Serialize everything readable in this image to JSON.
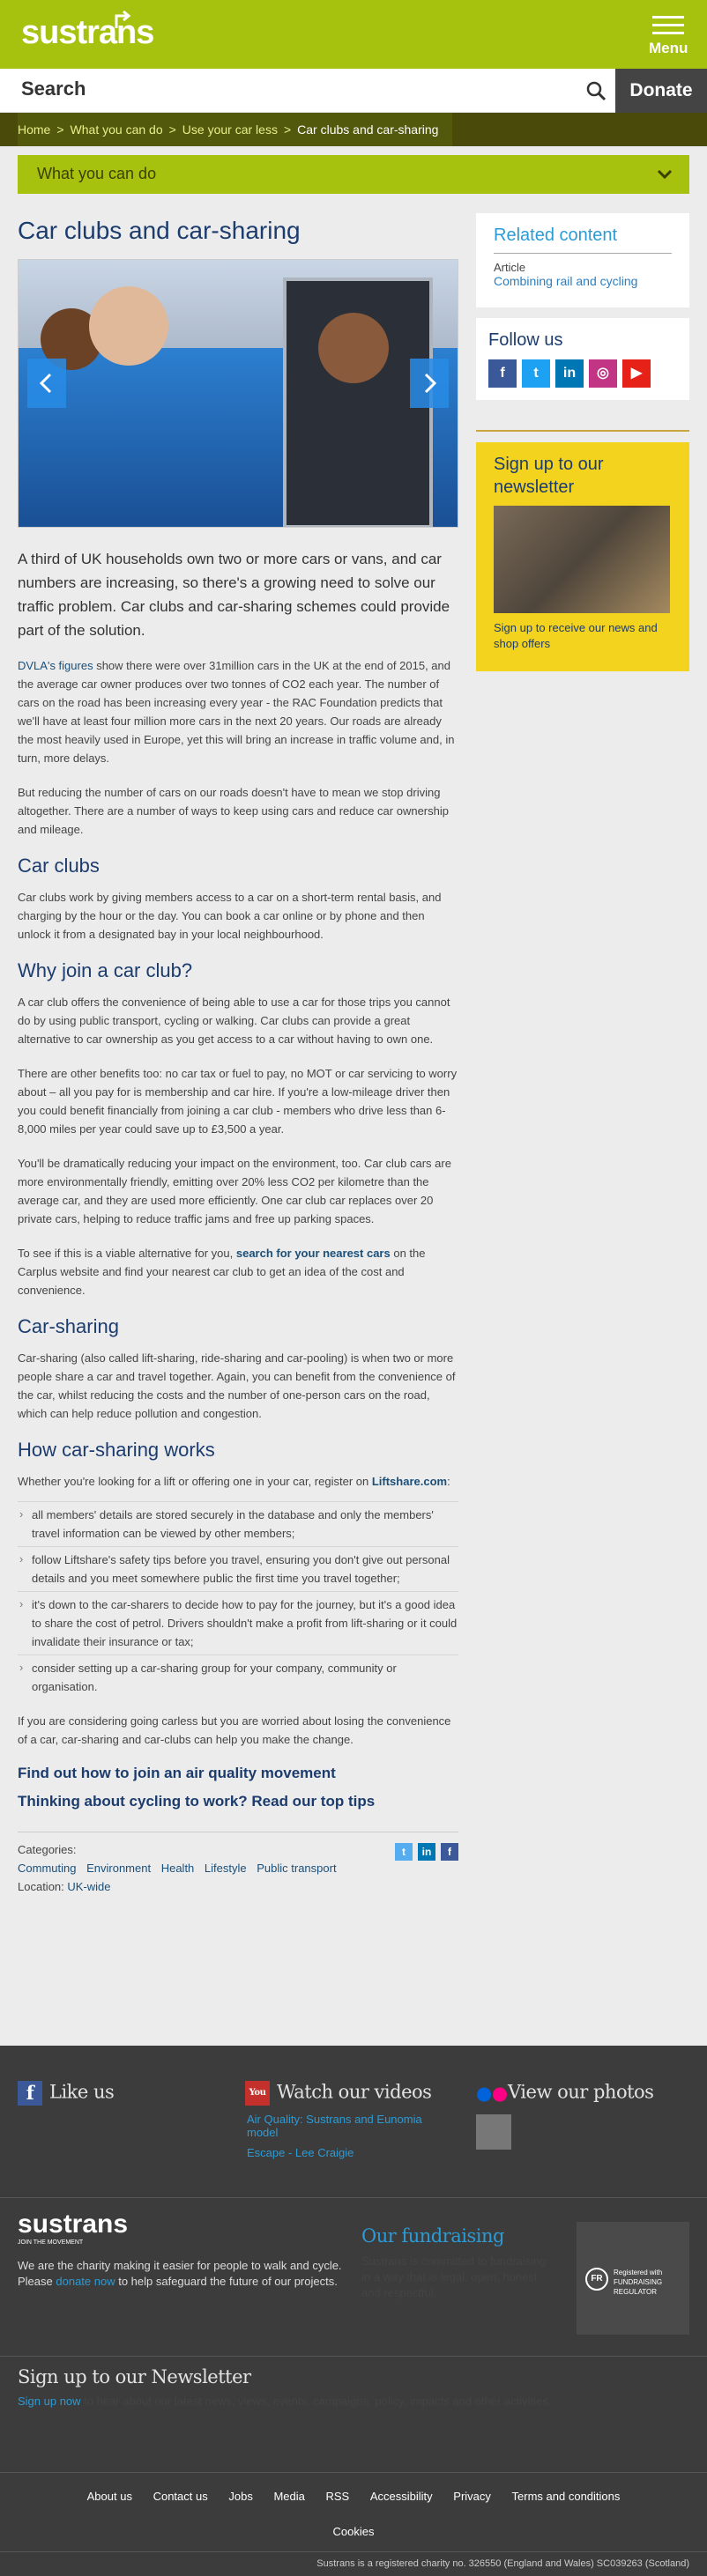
{
  "header": {
    "logo": "sustrans",
    "menu_label": "Menu",
    "search_placeholder": "Search",
    "donate": "Donate"
  },
  "breadcrumb": [
    "Home",
    "What you can do",
    "Use your car less",
    "Car clubs and car-sharing"
  ],
  "section_toggle": "What you can do",
  "page": {
    "title": "Car clubs and car-sharing",
    "lede": "A third of UK households own two or more cars or vans, and car numbers are increasing, so there's a growing need to solve our traffic problem. Car clubs and car-sharing schemes could provide part of the solution.",
    "p1_link": "DVLA's figures",
    "p1": " show there were over 31million cars in the UK at the end of 2015, and the average car owner produces over two tonnes of CO2 each year. The number of cars on the road has been increasing every year - the RAC Foundation predicts that we'll have at least four million more cars in the next 20 years. Our roads are already the most heavily used in Europe, yet this will bring an increase in traffic volume and, in turn, more delays.",
    "p2": "But reducing the number of cars on our roads doesn't have to mean we stop driving altogether. There are a number of ways to keep using cars and reduce car ownership and mileage.",
    "h_clubs": "Car clubs",
    "p3": "Car clubs work by giving members access to a car on a short-term rental basis, and charging by the hour or the day. You can book a car online or by phone and then unlock it from a designated bay in your local neighbourhood.",
    "h_why": "Why join a car club?",
    "p4": "A car club offers the convenience of being able to use a car for those trips you cannot do by using public transport, cycling or walking. Car clubs can provide a great alternative to car ownership as you get access to a car without having to own one.",
    "p5": "There are other benefits too: no car tax or fuel to pay, no MOT or car servicing to worry about – all you pay for is membership and car hire. If you're a low-mileage driver then you could benefit financially from joining a car club - members who drive less than 6-8,000 miles per year could save up to £3,500 a year.",
    "p6": "You'll be dramatically reducing your impact on the environment, too. Car club cars are more environmentally friendly, emitting over 20% less CO2 per kilometre than the average car, and they are used more efficiently. One car club car replaces over 20 private cars, helping to reduce traffic jams and free up parking spaces.",
    "p7_a": "To see if this is a viable alternative for you, ",
    "p7_link": "search for your nearest cars",
    "p7_b": " on the Carplus website and find your nearest car club to get an idea of the cost and convenience.",
    "h_sharing": "Car-sharing",
    "p8": "Car-sharing (also called lift-sharing, ride-sharing and car-pooling) is when two or more people share a car and travel together. Again, you can benefit from the convenience of the car, whilst reducing the costs and the number of one-person cars on the road, which can help reduce pollution and congestion.",
    "h_how": "How car-sharing works",
    "p9_a": "Whether you're looking for a lift or offering one in your car, register on ",
    "p9_link": "Liftshare.com",
    "p9_b": ":",
    "bullets": [
      "all members' details are stored securely in the database and only the members' travel information can be viewed by other members;",
      "follow Liftshare's safety tips before you travel, ensuring you don't give out personal details and you meet somewhere public the first time you travel together;",
      "it's down to the car-sharers to decide how to pay for the journey, but it's a good idea to share the cost of petrol. Drivers shouldn't make a profit from lift-sharing or it could invalidate their insurance or tax;",
      "consider setting up a car-sharing group for your company, community or organisation."
    ],
    "p10": "If you are considering going carless but you are worried about losing the convenience of a car, car-sharing and car-clubs can help you make the change.",
    "cta1": "Find out how to join an air quality movement",
    "cta2": "Thinking about cycling to work? Read our top tips",
    "categories_label": "Categories:",
    "categories": [
      "Commuting",
      "Environment",
      "Health",
      "Lifestyle",
      "Public transport"
    ],
    "location_label": "Location:",
    "location": "UK-wide"
  },
  "sidebar": {
    "related_title": "Related content",
    "related_type": "Article",
    "related_link": "Combining rail and cycling",
    "follow_title": "Follow us",
    "newsletter_title": "Sign up to our newsletter",
    "newsletter_text": "Sign up to receive our news and shop offers"
  },
  "footer": {
    "like": "Like us",
    "watch": "Watch our videos",
    "video1": "Air Quality: Sustrans and Eunomia model",
    "video2": "Escape - Lee Craigie",
    "photos": "View our photos",
    "org_text_a": "We are the charity making it easier for people to walk and cycle. Please ",
    "org_link": "donate now",
    "org_text_b": " to help safeguard the future of our projects.",
    "fund_title": "Our fundraising",
    "fund_text": "Sustrans is committed to fundraising in a way that is legal, open, honest and respectful.",
    "reg_badge": "Registered with FUNDRAISING REGULATOR",
    "news_title": "Sign up to our Newsletter",
    "news_link": "Sign up now",
    "news_text": " to hear about our latest news, views, events, campaigns, policy, impacts and other activities.",
    "links": [
      "About us",
      "Contact us",
      "Jobs",
      "Media",
      "RSS",
      "Accessibility",
      "Privacy",
      "Terms and conditions",
      "Cookies"
    ],
    "charity": "Sustrans is a registered charity no. 326550 (England and Wales) SC039263 (Scotland)"
  },
  "colors": {
    "brand_green": "#a7c10f",
    "navy": "#1c3c6e",
    "yellow": "#f4d31f",
    "dark": "#3c3c3c"
  }
}
